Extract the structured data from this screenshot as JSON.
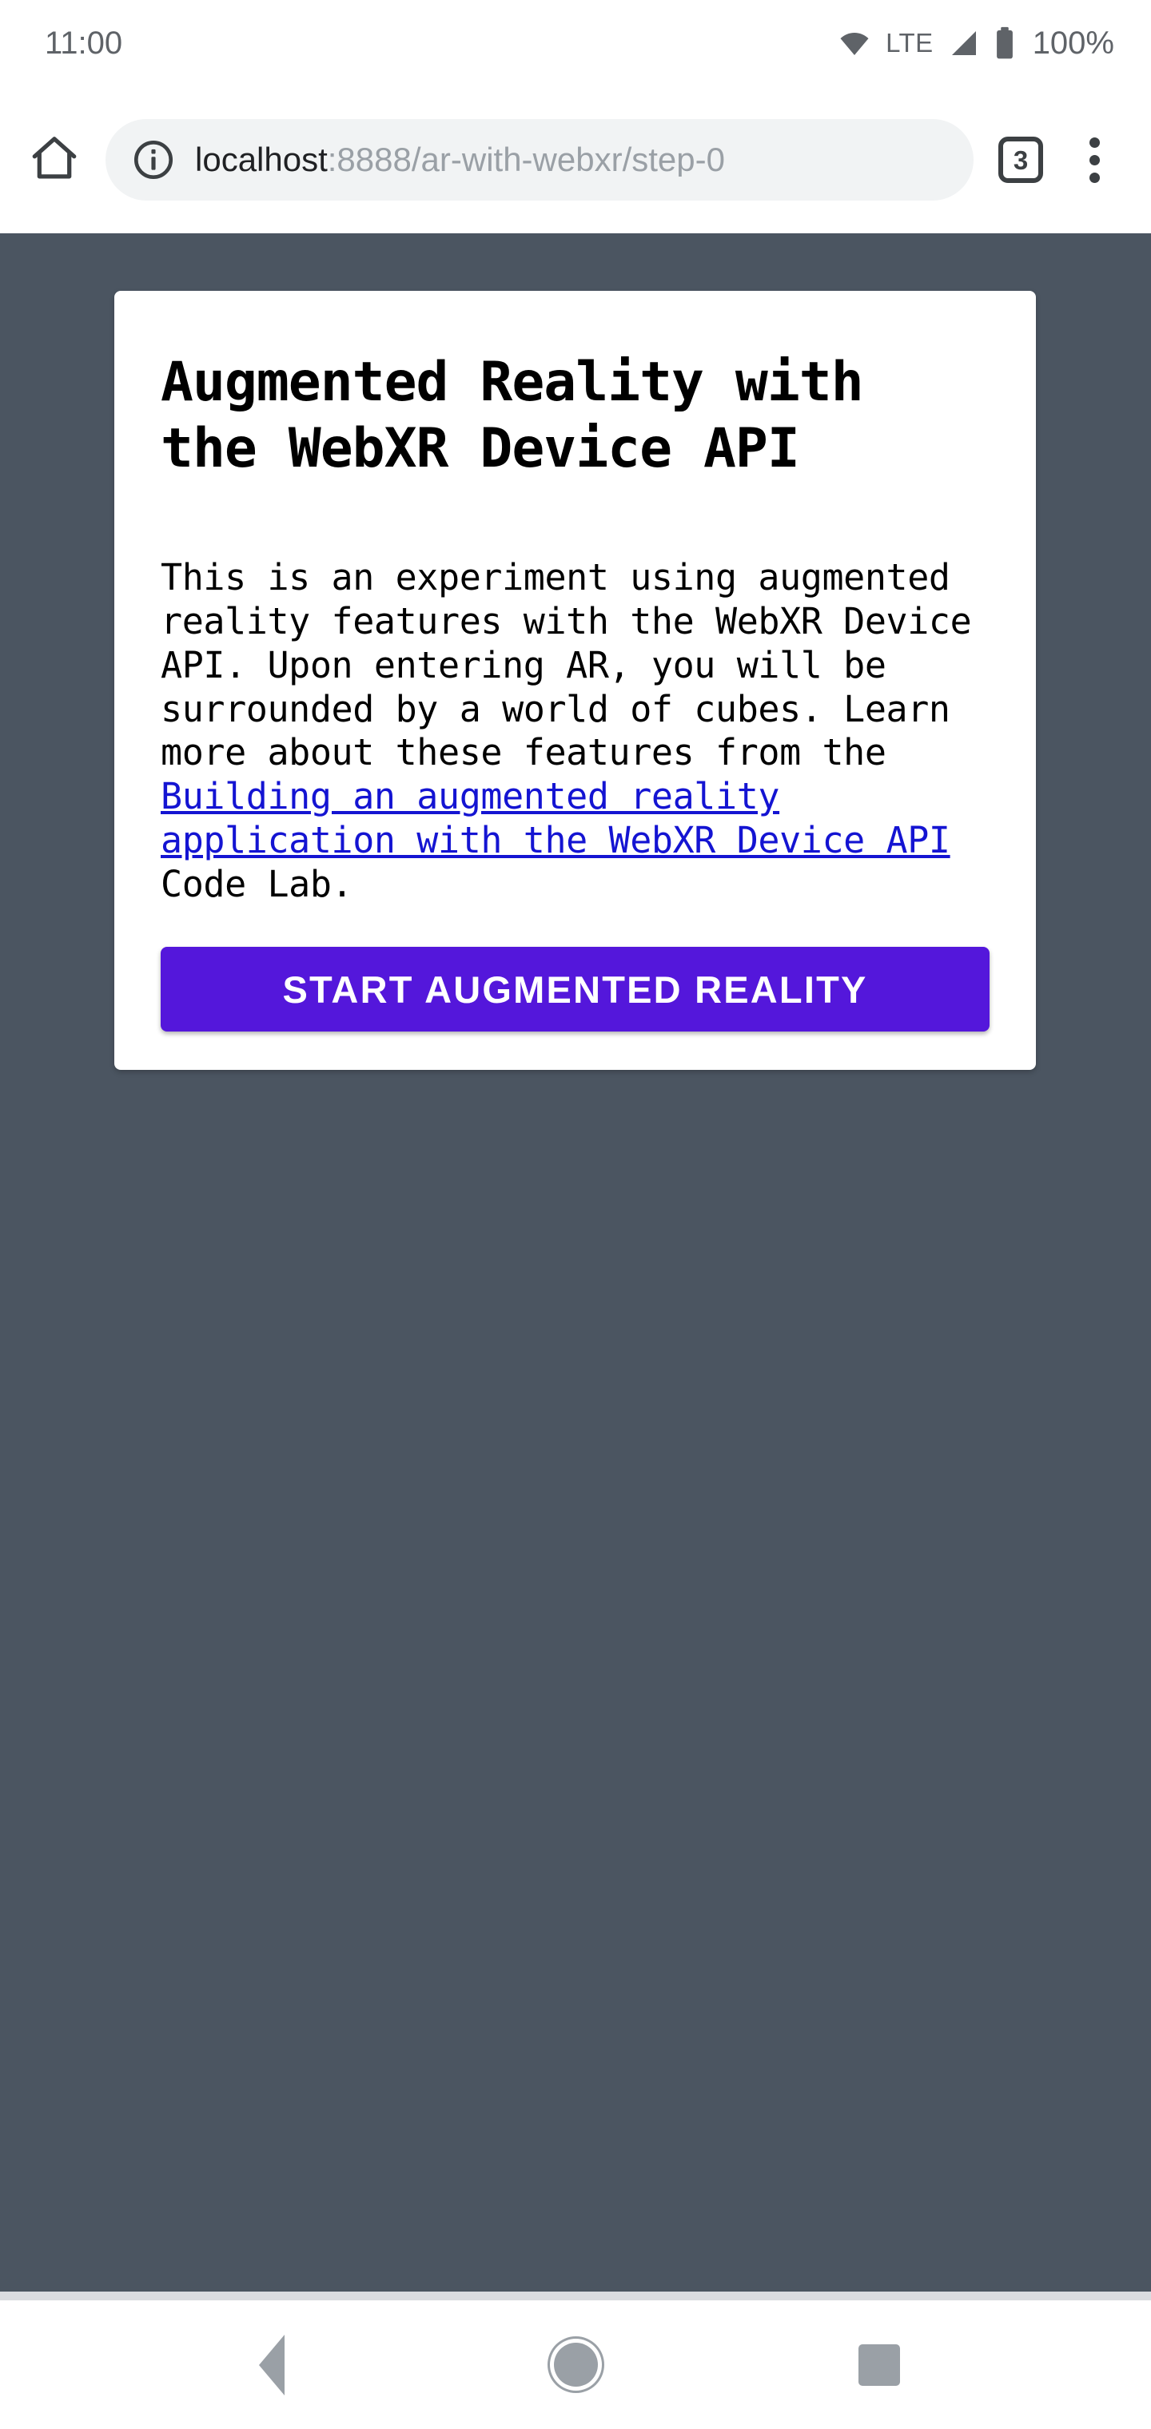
{
  "status_bar": {
    "clock": "11:00",
    "wifi_icon": "wifi-icon",
    "network_label": "LTE",
    "signal_icon": "cellular-signal-icon",
    "battery_icon": "battery-icon",
    "battery_percent": "100%"
  },
  "browser": {
    "home_icon": "home-icon",
    "security_icon": "info-icon",
    "url_host": "localhost",
    "url_path": ":8888/ar-with-webxr/step-0",
    "url_full": "localhost:8888/ar-with-webxr/step-0",
    "tab_count": "3",
    "menu_icon": "overflow-menu-icon"
  },
  "page": {
    "background_color": "#4b5561",
    "card": {
      "title": "Augmented Reality with the WebXR Device API",
      "paragraph_before_link": "This is an experiment using augmented reality features with the WebXR Device API. Upon entering AR, you will be surrounded by a world of cubes. Learn more about these features from the ",
      "link_text": "Building an augmented reality application with the WebXR Device API",
      "paragraph_after_link": " Code Lab.",
      "link_color": "#1414d2",
      "button_label": "Start augmented reality",
      "button_color": "#5417db",
      "button_text_color": "#ffffff"
    }
  },
  "navigation_bar": {
    "back_label": "Back",
    "home_label": "Home",
    "recents_label": "Recents"
  }
}
